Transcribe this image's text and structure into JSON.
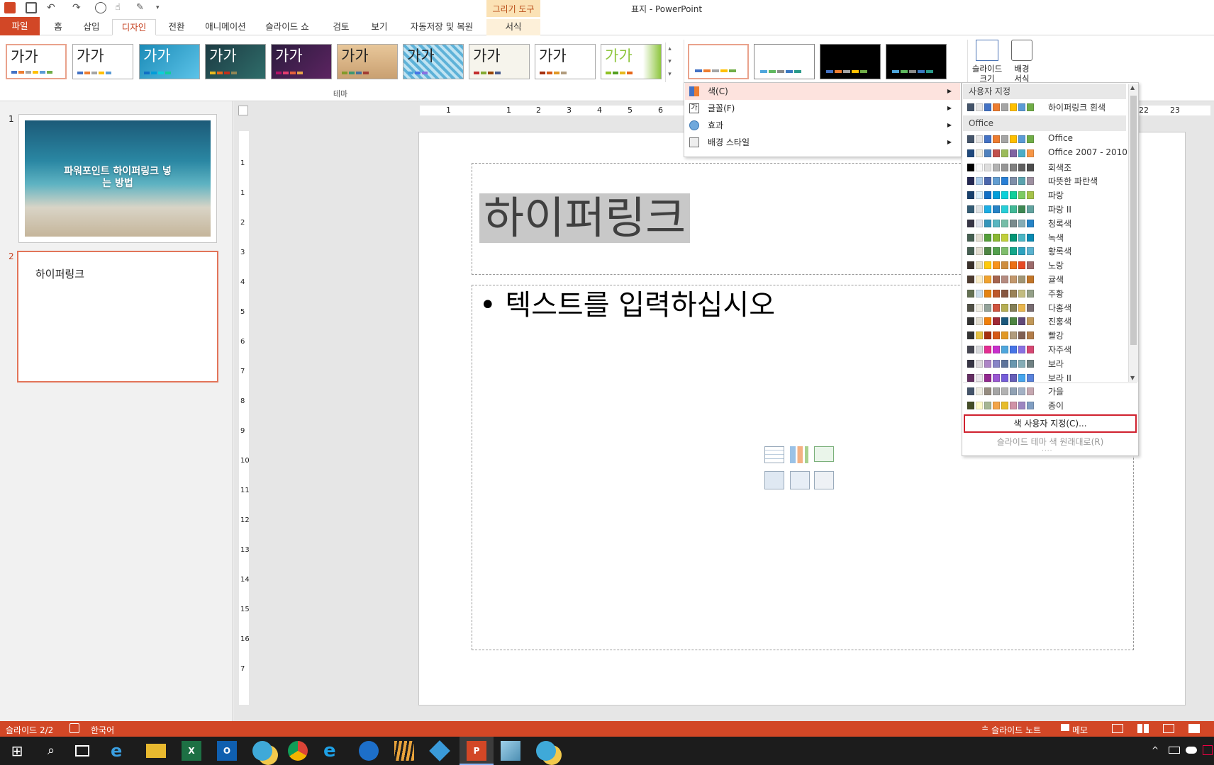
{
  "window_title": "표지 - PowerPoint",
  "contextual_tab_group": "그리기 도구",
  "tabs": [
    {
      "label": "파일"
    },
    {
      "label": "홈"
    },
    {
      "label": "삽입"
    },
    {
      "label": "디자인"
    },
    {
      "label": "전환"
    },
    {
      "label": "애니메이션"
    },
    {
      "label": "슬라이드 쇼"
    },
    {
      "label": "검토"
    },
    {
      "label": "보기"
    },
    {
      "label": "자동저장 및 복원"
    },
    {
      "label": "서식"
    }
  ],
  "ribbon": {
    "theme_group_label": "테마",
    "theme_sample_text": "가가",
    "slide_size_label": "슬라이드 크기",
    "background_format_label": "배경 서식"
  },
  "slides_pane": {
    "slide1_number": "1",
    "slide1_title": "파워포인트 하이퍼링크 넣는 방법",
    "slide2_number": "2",
    "slide2_title": "하이퍼링크"
  },
  "slide": {
    "title": "하이퍼링크",
    "body_placeholder": "텍스트를 입력하십시오"
  },
  "ruler": {
    "h": [
      "1",
      "1",
      "2",
      "3",
      "4",
      "5",
      "6",
      "22",
      "23"
    ],
    "v": [
      "1",
      "1",
      "2",
      "3",
      "4",
      "5",
      "6",
      "7",
      "8",
      "9",
      "10",
      "11",
      "12",
      "13",
      "14",
      "15",
      "16",
      "7"
    ]
  },
  "variants_menu": {
    "items": [
      {
        "label": "색(C)",
        "icon": "color-palette-icon"
      },
      {
        "label": "글꼴(F)",
        "icon": "font-icon"
      },
      {
        "label": "효과",
        "icon": "effects-icon"
      },
      {
        "label": "배경 스타일",
        "icon": "background-style-icon"
      }
    ]
  },
  "color_submenu": {
    "custom_header": "사용자 지정",
    "custom_scheme": {
      "name": "하이퍼링크 흰색",
      "colors": [
        "#44546a",
        "#e7e6e6",
        "#4472c4",
        "#ed7d31",
        "#a5a5a5",
        "#ffc000",
        "#5b9bd5",
        "#70ad47"
      ]
    },
    "office_header": "Office",
    "schemes": [
      {
        "name": "Office",
        "colors": [
          "#44546a",
          "#e7e6e6",
          "#4472c4",
          "#ed7d31",
          "#a5a5a5",
          "#ffc000",
          "#5b9bd5",
          "#70ad47"
        ]
      },
      {
        "name": "Office 2007 - 2010",
        "colors": [
          "#1f497d",
          "#eeece1",
          "#4f81bd",
          "#c0504d",
          "#9bbb59",
          "#8064a2",
          "#4bacc6",
          "#f79646"
        ]
      },
      {
        "name": "회색조",
        "colors": [
          "#000000",
          "#f8f8f8",
          "#dddddd",
          "#b2b2b2",
          "#969696",
          "#808080",
          "#5f5f5f",
          "#4d4d4d"
        ]
      },
      {
        "name": "따뜻한 파란색",
        "colors": [
          "#242852",
          "#acccea",
          "#4a66ac",
          "#629dd1",
          "#297fd5",
          "#7f8fa9",
          "#5aa2ae",
          "#9d90a0"
        ]
      },
      {
        "name": "파랑",
        "colors": [
          "#17406d",
          "#dbeff9",
          "#0f6fc6",
          "#009dd9",
          "#0bd0d9",
          "#10cf9b",
          "#7cca62",
          "#a5c249"
        ]
      },
      {
        "name": "파랑 II",
        "colors": [
          "#335b74",
          "#dfe3e5",
          "#1cade4",
          "#2683c6",
          "#27ced7",
          "#42ba97",
          "#3e8853",
          "#62a39f"
        ]
      },
      {
        "name": "청록색",
        "colors": [
          "#373545",
          "#dee2eb",
          "#3494ba",
          "#58b6c0",
          "#75bda7",
          "#7a8c8e",
          "#84acb6",
          "#2683c6"
        ]
      },
      {
        "name": "녹색",
        "colors": [
          "#455f51",
          "#e3ded1",
          "#549e39",
          "#8ab833",
          "#c0cf3a",
          "#029676",
          "#4ab5c4",
          "#0989b1"
        ]
      },
      {
        "name": "황록색",
        "colors": [
          "#455f51",
          "#e3ded1",
          "#4e8542",
          "#53a04d",
          "#7fbd6c",
          "#15a78b",
          "#2da2bf",
          "#5ab2cf"
        ]
      },
      {
        "name": "노랑",
        "colors": [
          "#39302a",
          "#e5dec2",
          "#ffca08",
          "#f8931d",
          "#ce8d3e",
          "#ec7016",
          "#e64823",
          "#9c6a6a"
        ]
      },
      {
        "name": "귤색",
        "colors": [
          "#4e3b30",
          "#fbeec9",
          "#f0a22e",
          "#a5644e",
          "#b58b80",
          "#c3986d",
          "#a19574",
          "#c17529"
        ]
      },
      {
        "name": "주황",
        "colors": [
          "#637052",
          "#ccddea",
          "#e48312",
          "#bd582c",
          "#865640",
          "#9b8357",
          "#c2bc80",
          "#94a088"
        ]
      },
      {
        "name": "다홍색",
        "colors": [
          "#505046",
          "#eeece1",
          "#93a299",
          "#cf543f",
          "#b5ae53",
          "#848058",
          "#e8b54d",
          "#786c71"
        ]
      },
      {
        "name": "진홍색",
        "colors": [
          "#323232",
          "#e3ded1",
          "#f07f09",
          "#9f2936",
          "#1b587c",
          "#4e8542",
          "#604878",
          "#c19859"
        ]
      },
      {
        "name": "빨강",
        "colors": [
          "#323232",
          "#e5c243",
          "#a5300f",
          "#d55816",
          "#e19825",
          "#b19c7d",
          "#7f5f52",
          "#b27d49"
        ]
      },
      {
        "name": "자주색",
        "colors": [
          "#454551",
          "#d8d9dc",
          "#e32d91",
          "#c830cc",
          "#4ea6dc",
          "#4775e7",
          "#8971e1",
          "#d54773"
        ]
      },
      {
        "name": "보라",
        "colors": [
          "#373545",
          "#dcd8dc",
          "#ad84c6",
          "#8784c7",
          "#5d739a",
          "#6997af",
          "#84acb6",
          "#6f8183"
        ]
      },
      {
        "name": "보라 II",
        "colors": [
          "#632e62",
          "#eae5eb",
          "#92278f",
          "#9b57d3",
          "#755dd9",
          "#665eb8",
          "#45a5ed",
          "#5982db"
        ]
      },
      {
        "name": "가을",
        "colors": [
          "#44546a",
          "#eeece1",
          "#958b7f",
          "#a5a5a5",
          "#b2b2b2",
          "#91a2b4",
          "#a3b1c5",
          "#c5a7b0"
        ]
      },
      {
        "name": "종이",
        "colors": [
          "#444d26",
          "#fefac9",
          "#a5b592",
          "#f3a447",
          "#e7bc29",
          "#d092a7",
          "#9c85c0",
          "#809ec2"
        ]
      }
    ],
    "customize_colors": "색 사용자 지정(C)...",
    "reset_colors": "슬라이드 테마 색 원래대로(R)"
  },
  "status_bar": {
    "slide_indicator": "슬라이드 2/2",
    "language": "한국어",
    "notes": "슬라이드 노트",
    "comments": "메모"
  },
  "accent": "#d24726"
}
